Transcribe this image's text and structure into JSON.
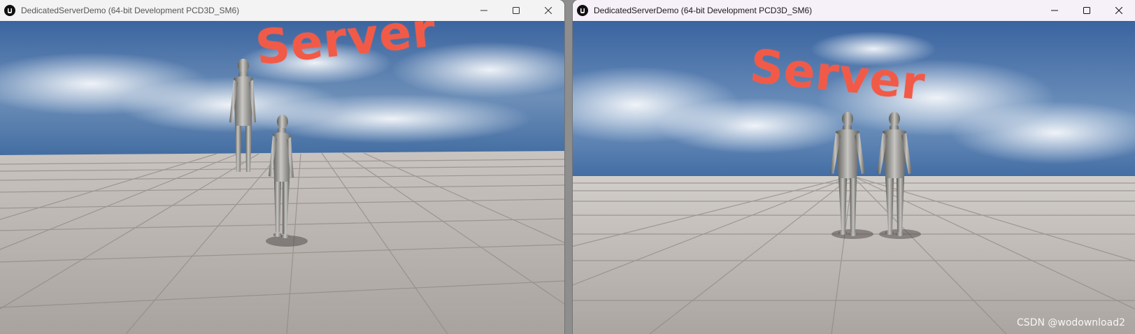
{
  "windows": [
    {
      "title": "DedicatedServerDemo (64-bit Development PCD3D_SM6)",
      "scene_text": "Server",
      "controls": [
        "minimize",
        "maximize",
        "close"
      ]
    },
    {
      "title": "DedicatedServerDemo (64-bit Development PCD3D_SM6)",
      "scene_text": "Server",
      "controls": [
        "minimize",
        "maximize",
        "close"
      ]
    }
  ],
  "watermark": "CSDN @wodownload2",
  "colors": {
    "scene_text": "#f25a48",
    "sky_top": "#3e6aa4",
    "horizon": "#4a72a8",
    "floor": "#b8b2ad",
    "mannequin": "#9a9a98"
  },
  "icons": {
    "app": "unreal-engine-logo-icon",
    "minimize": "minimize-icon",
    "maximize": "maximize-icon",
    "close": "close-icon"
  }
}
